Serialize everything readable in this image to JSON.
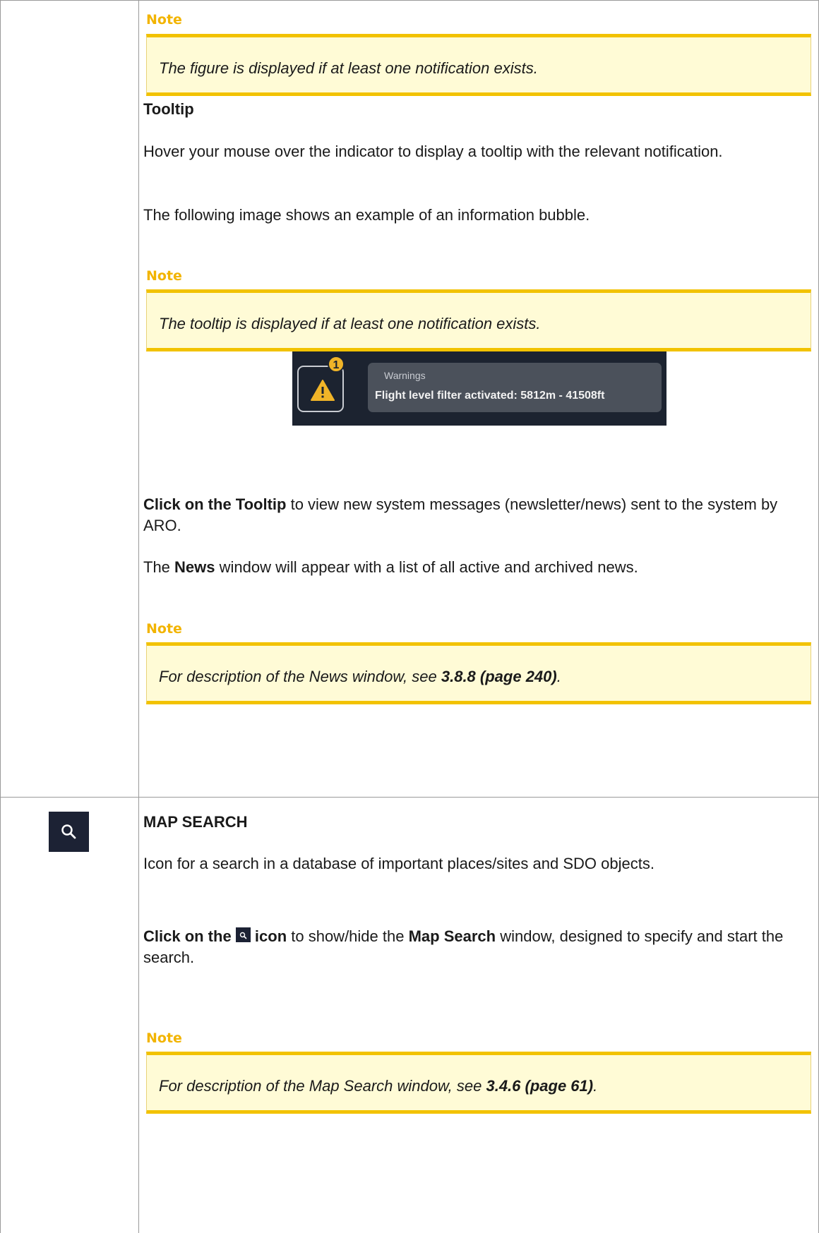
{
  "note_label": "Note",
  "notes": [
    {
      "text": "The figure is displayed if at least one notification exists."
    },
    {
      "text": "The tooltip is displayed if at least one notification exists."
    },
    {
      "prefix": "For description of the News window, see ",
      "ref": "3.8.8 (page 240)",
      "suffix": "."
    },
    {
      "prefix": "For description of the Map Search window, see ",
      "ref": "3.4.6 (page 61)",
      "suffix": "."
    }
  ],
  "tooltip_section": {
    "heading": "Tooltip",
    "para1": "Hover your mouse over the indicator to display a tooltip with the relevant notification.",
    "para2": "The following image shows an example of an information bubble.",
    "click_bold": "Click on the Tooltip",
    "click_rest": " to view new system messages (newsletter/news) sent to the system by ARO.",
    "news_pre": "The ",
    "news_bold": "News",
    "news_post": " window will appear with a list of all active and archived news."
  },
  "screenshot": {
    "badge_count": "1",
    "bubble_title": "Warnings",
    "bubble_text": "Flight level filter activated: 5812m - 41508ft"
  },
  "map_search": {
    "heading": "MAP SEARCH",
    "para1": "Icon for a search in a database of important places/sites and SDO objects.",
    "click_bold_1": "Click on the ",
    "click_bold_2": " icon",
    "click_mid": " to show/hide the ",
    "click_bold_3": "Map Search",
    "click_end": " window, designed to specify and start the search."
  },
  "colors": {
    "accent": "#f2c200",
    "note_bg": "#fffbd6",
    "icon_bg": "#1c2234"
  }
}
